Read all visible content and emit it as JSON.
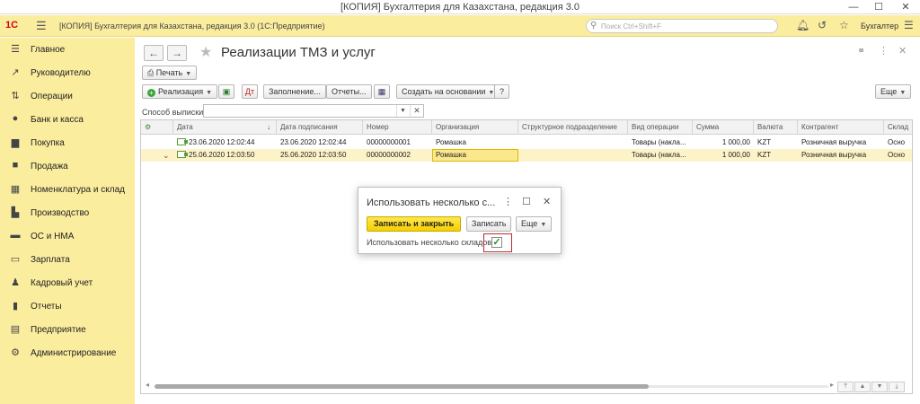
{
  "window": {
    "title": "[КОПИЯ] Бухгалтерия для Казахстана, редакция 3.0"
  },
  "app": {
    "logo": "1С",
    "title": "[КОПИЯ] Бухгалтерия для Казахстана, редакция 3.0  (1С:Предприятие)",
    "search_placeholder": "Поиск Ctrl+Shift+F",
    "user": "Бухгалтер"
  },
  "sidebar": {
    "items": [
      {
        "label": "Главное",
        "icon": "list-icon"
      },
      {
        "label": "Руководителю",
        "icon": "chart-line-icon"
      },
      {
        "label": "Операции",
        "icon": "operations-icon"
      },
      {
        "label": "Банк и касса",
        "icon": "bank-icon"
      },
      {
        "label": "Покупка",
        "icon": "cart-icon"
      },
      {
        "label": "Продажа",
        "icon": "bag-icon"
      },
      {
        "label": "Номенклатура и склад",
        "icon": "grid-icon"
      },
      {
        "label": "Производство",
        "icon": "factory-icon"
      },
      {
        "label": "ОС и НМА",
        "icon": "truck-icon"
      },
      {
        "label": "Зарплата",
        "icon": "money-icon"
      },
      {
        "label": "Кадровый учет",
        "icon": "people-icon"
      },
      {
        "label": "Отчеты",
        "icon": "bar-chart-icon"
      },
      {
        "label": "Предприятие",
        "icon": "building-icon"
      },
      {
        "label": "Администрирование",
        "icon": "gear-icon"
      }
    ]
  },
  "main": {
    "title": "Реализации ТМЗ и услуг",
    "print_btn": "Печать",
    "toolbar": {
      "realization": "Реализация",
      "fill": "Заполнение...",
      "reports": "Отчеты...",
      "create_based": "Создать на основании",
      "help": "?",
      "more": "Еще"
    },
    "filter_label": "Способ выписки:",
    "columns": [
      "Дата",
      "Дата подписания",
      "Номер",
      "Организация",
      "Структурное подразделение",
      "Вид операции",
      "Сумма",
      "Валюта",
      "Контрагент",
      "Склад"
    ],
    "rows": [
      {
        "date": "23.06.2020 12:02:44",
        "sign_date": "23.06.2020 12:02:44",
        "number": "00000000001",
        "org": "Ромашка",
        "dept": "",
        "op": "Товары (накла...",
        "sum": "1 000,00",
        "currency": "KZT",
        "counterparty": "Розничная выручка",
        "warehouse": "Осно"
      },
      {
        "date": "25.06.2020 12:03:50",
        "sign_date": "25.06.2020 12:03:50",
        "number": "00000000002",
        "org": "Ромашка",
        "dept": "",
        "op": "Товары (накла...",
        "sum": "1 000,00",
        "currency": "KZT",
        "counterparty": "Розничная выручка",
        "warehouse": "Осно"
      }
    ]
  },
  "dialog": {
    "title": "Использовать несколько с...",
    "save_close": "Записать и закрыть",
    "save": "Записать",
    "more": "Еще",
    "checkbox_label": "Использовать несколько складов:",
    "checkbox_checked": true
  }
}
